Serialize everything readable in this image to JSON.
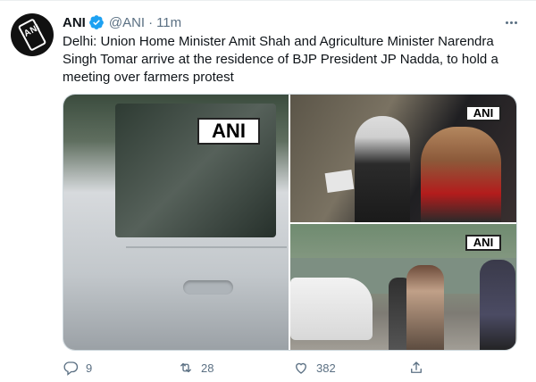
{
  "tweet": {
    "author_name": "ANI",
    "author_handle": "@ANI",
    "separator": "·",
    "time": "11m",
    "avatar_text": "ANI",
    "text": "Delhi: Union Home Minister Amit Shah and Agriculture Minister Narendra Singh Tomar arrive at the residence of BJP President JP Nadda, to hold a meeting over farmers protest",
    "verified": true
  },
  "media": {
    "photos": [
      {
        "watermark": "ANI"
      },
      {
        "watermark": "ANI"
      },
      {
        "watermark": "ANI"
      }
    ]
  },
  "actions": {
    "reply": {
      "icon": "reply-icon",
      "count": "9"
    },
    "retweet": {
      "icon": "retweet-icon",
      "count": "28"
    },
    "like": {
      "icon": "heart-icon",
      "count": "382"
    },
    "share": {
      "icon": "share-icon",
      "count": ""
    }
  },
  "colors": {
    "verified": "#1da1f2",
    "secondary_text": "#5b7083"
  }
}
